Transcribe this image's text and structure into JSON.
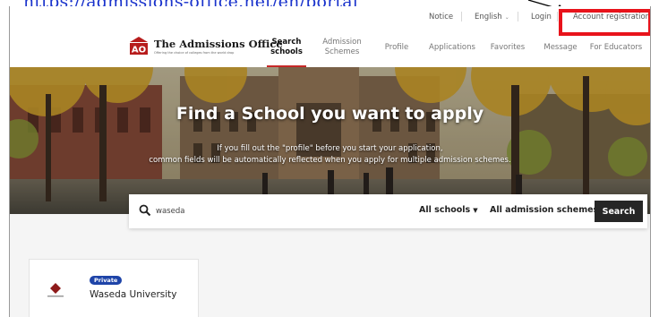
{
  "annotation": {
    "url_text": "https://admissions-office.net/en/portal",
    "highlight_color": "#e8131b"
  },
  "utility_nav": {
    "notice": "Notice",
    "language": "English",
    "login": "Login",
    "account_registration": "Account registration"
  },
  "logo": {
    "title": "The Admissions Office",
    "tagline": "Offering the choice of colleges from the world drop",
    "mark_text": "AO"
  },
  "main_nav": {
    "items": [
      {
        "label": "Search schools",
        "active": true
      },
      {
        "label": "Admission Schemes",
        "active": false
      },
      {
        "label": "Profile",
        "active": false
      },
      {
        "label": "Applications",
        "active": false
      },
      {
        "label": "Favorites",
        "active": false
      },
      {
        "label": "Message",
        "active": false
      },
      {
        "label": "For Educators",
        "active": false
      }
    ],
    "active_color": "#c62828"
  },
  "hero": {
    "title": "Find a School you want to apply",
    "subtitle_line1": "If you fill out the \"profile\" before you start your application,",
    "subtitle_line2": "common fields will be automatically reflected when you apply for multiple admission schemes."
  },
  "search": {
    "icon": "search-icon",
    "query": "waseda",
    "schools_dropdown": "All schools",
    "schemes_dropdown": "All admission schemes",
    "button_label": "Search"
  },
  "results": [
    {
      "badge": "Private",
      "name": "Waseda University",
      "badge_color": "#1e44a8"
    }
  ]
}
